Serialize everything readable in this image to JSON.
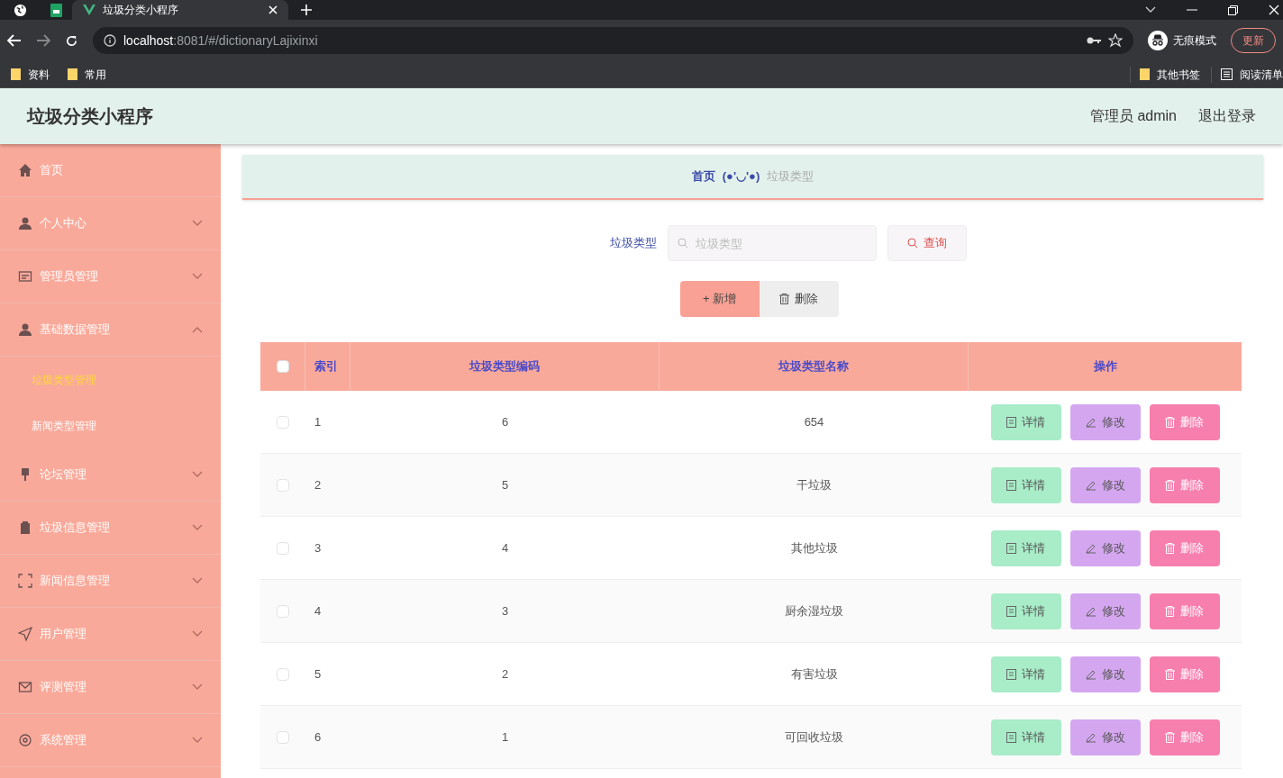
{
  "browser": {
    "tab_title": "垃圾分类小程序",
    "url_host": "localhost",
    "url_rest": ":8081/#/dictionaryLajixinxi",
    "profile": "无痕模式",
    "update_button": "更新",
    "bookmarks": [
      "资料",
      "常用"
    ],
    "other_bookmarks": "其他书签",
    "reading_list": "阅读清单"
  },
  "header": {
    "title": "垃圾分类小程序",
    "user": "管理员 admin",
    "logout": "退出登录"
  },
  "sidebar": [
    {
      "label": "首页"
    },
    {
      "label": "个人中心",
      "expanded": false
    },
    {
      "label": "管理员管理",
      "expanded": false
    },
    {
      "label": "基础数据管理",
      "expanded": true,
      "children": [
        {
          "label": "垃圾类型管理",
          "selected": true
        },
        {
          "label": "新闻类型管理",
          "selected": false
        }
      ]
    },
    {
      "label": "论坛管理",
      "expanded": false
    },
    {
      "label": "垃圾信息管理",
      "expanded": false
    },
    {
      "label": "新闻信息管理",
      "expanded": false
    },
    {
      "label": "用户管理",
      "expanded": false
    },
    {
      "label": "评测管理",
      "expanded": false
    },
    {
      "label": "系统管理",
      "expanded": false
    }
  ],
  "breadcrumb": {
    "home": "首页",
    "separator": "(●'◡'●)",
    "current": "垃圾类型"
  },
  "search": {
    "label": "垃圾类型",
    "placeholder": "垃圾类型",
    "button": "查询"
  },
  "actions": {
    "add": "+ 新增",
    "delete": "删除"
  },
  "table": {
    "all_checked": false,
    "columns": [
      "索引",
      "垃圾类型编码",
      "垃圾类型名称",
      "操作"
    ],
    "rows": [
      {
        "index": "1",
        "code": "6",
        "name": "654",
        "checked": false,
        "buttons": [
          "详情",
          "修改",
          "删除"
        ]
      },
      {
        "index": "2",
        "code": "5",
        "name": "干垃圾",
        "checked": false,
        "buttons": [
          "详情",
          "修改",
          "删除"
        ]
      },
      {
        "index": "3",
        "code": "4",
        "name": "其他垃圾",
        "checked": false,
        "buttons": [
          "详情",
          "修改",
          "删除"
        ]
      },
      {
        "index": "4",
        "code": "3",
        "name": "厨余湿垃圾",
        "checked": false,
        "buttons": [
          "详情",
          "修改",
          "删除"
        ]
      },
      {
        "index": "5",
        "code": "2",
        "name": "有害垃圾",
        "checked": false,
        "buttons": [
          "详情",
          "修改",
          "删除"
        ]
      },
      {
        "index": "6",
        "code": "1",
        "name": "可回收垃圾",
        "checked": false,
        "buttons": [
          "详情",
          "修改",
          "删除"
        ]
      }
    ]
  }
}
